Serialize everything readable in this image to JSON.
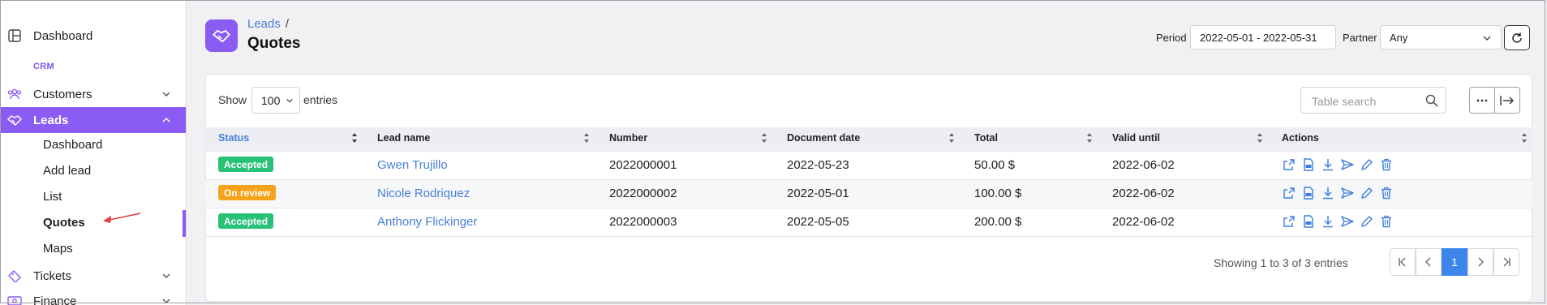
{
  "sidebar": {
    "items": [
      {
        "label": "Dashboard",
        "icon": "table-layout-icon"
      },
      {
        "label": "Customers",
        "icon": "users-icon"
      },
      {
        "label": "Leads",
        "icon": "handshake-icon"
      },
      {
        "label": "Tickets",
        "icon": "ticket-icon"
      },
      {
        "label": "Finance",
        "icon": "money-icon"
      }
    ],
    "section_crm": "CRM",
    "lead_subitems": [
      "Dashboard",
      "Add lead",
      "List",
      "Quotes",
      "Maps"
    ],
    "accent": "#8a5cf4"
  },
  "header": {
    "breadcrumb": "Leads",
    "breadcrumb_sep": "/",
    "title": "Quotes",
    "icon": "handshake-icon"
  },
  "filters": {
    "period_label": "Period",
    "period_value": "2022-05-01 - 2022-05-31",
    "partner_label": "Partner",
    "partner_value": "Any"
  },
  "table_controls": {
    "show_label": "Show",
    "entries_value": "100",
    "entries_label": "entries",
    "search_placeholder": "Table search"
  },
  "table": {
    "columns": [
      "Status",
      "Lead name",
      "Number",
      "Document date",
      "Total",
      "Valid until",
      "Actions"
    ],
    "rows": [
      {
        "status": "Accepted",
        "status_color": "#28c178",
        "lead_name": "Gwen Trujillo",
        "number": "2022000001",
        "document_date": "2022-05-23",
        "total": "50.00 $",
        "valid_until": "2022-06-02"
      },
      {
        "status": "On review",
        "status_color": "#f7a21b",
        "lead_name": "Nicole Rodriquez",
        "number": "2022000002",
        "document_date": "2022-05-01",
        "total": "100.00 $",
        "valid_until": "2022-06-02"
      },
      {
        "status": "Accepted",
        "status_color": "#28c178",
        "lead_name": "Anthony Flickinger",
        "number": "2022000003",
        "document_date": "2022-05-05",
        "total": "200.00 $",
        "valid_until": "2022-06-02"
      }
    ],
    "action_icons": [
      "open-external-icon",
      "pdf-icon",
      "download-icon",
      "send-icon",
      "edit-icon",
      "delete-icon"
    ]
  },
  "pagination": {
    "info": "Showing 1 to 3 of 3 entries",
    "current_page": "1"
  }
}
